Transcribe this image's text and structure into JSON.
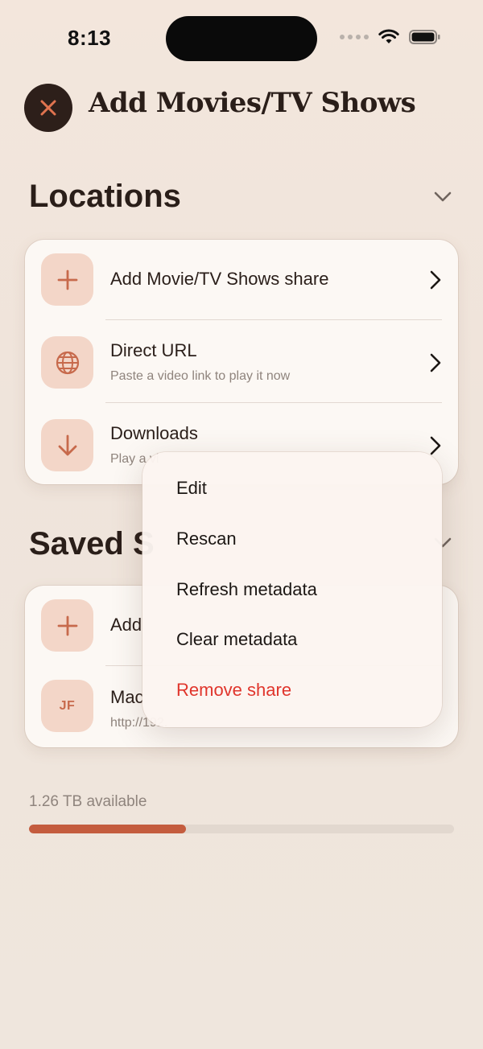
{
  "status_bar": {
    "time": "8:13"
  },
  "header": {
    "title": "Add Movies/TV Shows"
  },
  "locations": {
    "title": "Locations",
    "items": [
      {
        "title": "Add Movie/TV Shows share",
        "icon": "plus-icon"
      },
      {
        "title": "Direct URL",
        "subtitle": "Paste a video link to play it now",
        "icon": "globe-icon"
      },
      {
        "title": "Downloads",
        "subtitle": "Play a vi",
        "icon": "download-arrow-icon"
      }
    ]
  },
  "saved_shares": {
    "title": "Saved S",
    "items": [
      {
        "title": "Add",
        "icon": "plus-icon"
      },
      {
        "title": "Mac",
        "subtitle": "http://192.",
        "initials": "JF"
      }
    ]
  },
  "storage": {
    "label": "1.26 TB available",
    "used_fraction": 0.37
  },
  "context_menu": {
    "items": [
      {
        "label": "Edit",
        "destructive": false
      },
      {
        "label": "Rescan",
        "destructive": false
      },
      {
        "label": "Refresh metadata",
        "destructive": false
      },
      {
        "label": "Clear metadata",
        "destructive": false
      },
      {
        "label": "Remove share",
        "destructive": true
      }
    ]
  },
  "colors": {
    "accent": "#c45c3e",
    "icon_tile": "#f3d6c8",
    "destructive": "#e0352c",
    "close_button": "#2d1f1a"
  }
}
